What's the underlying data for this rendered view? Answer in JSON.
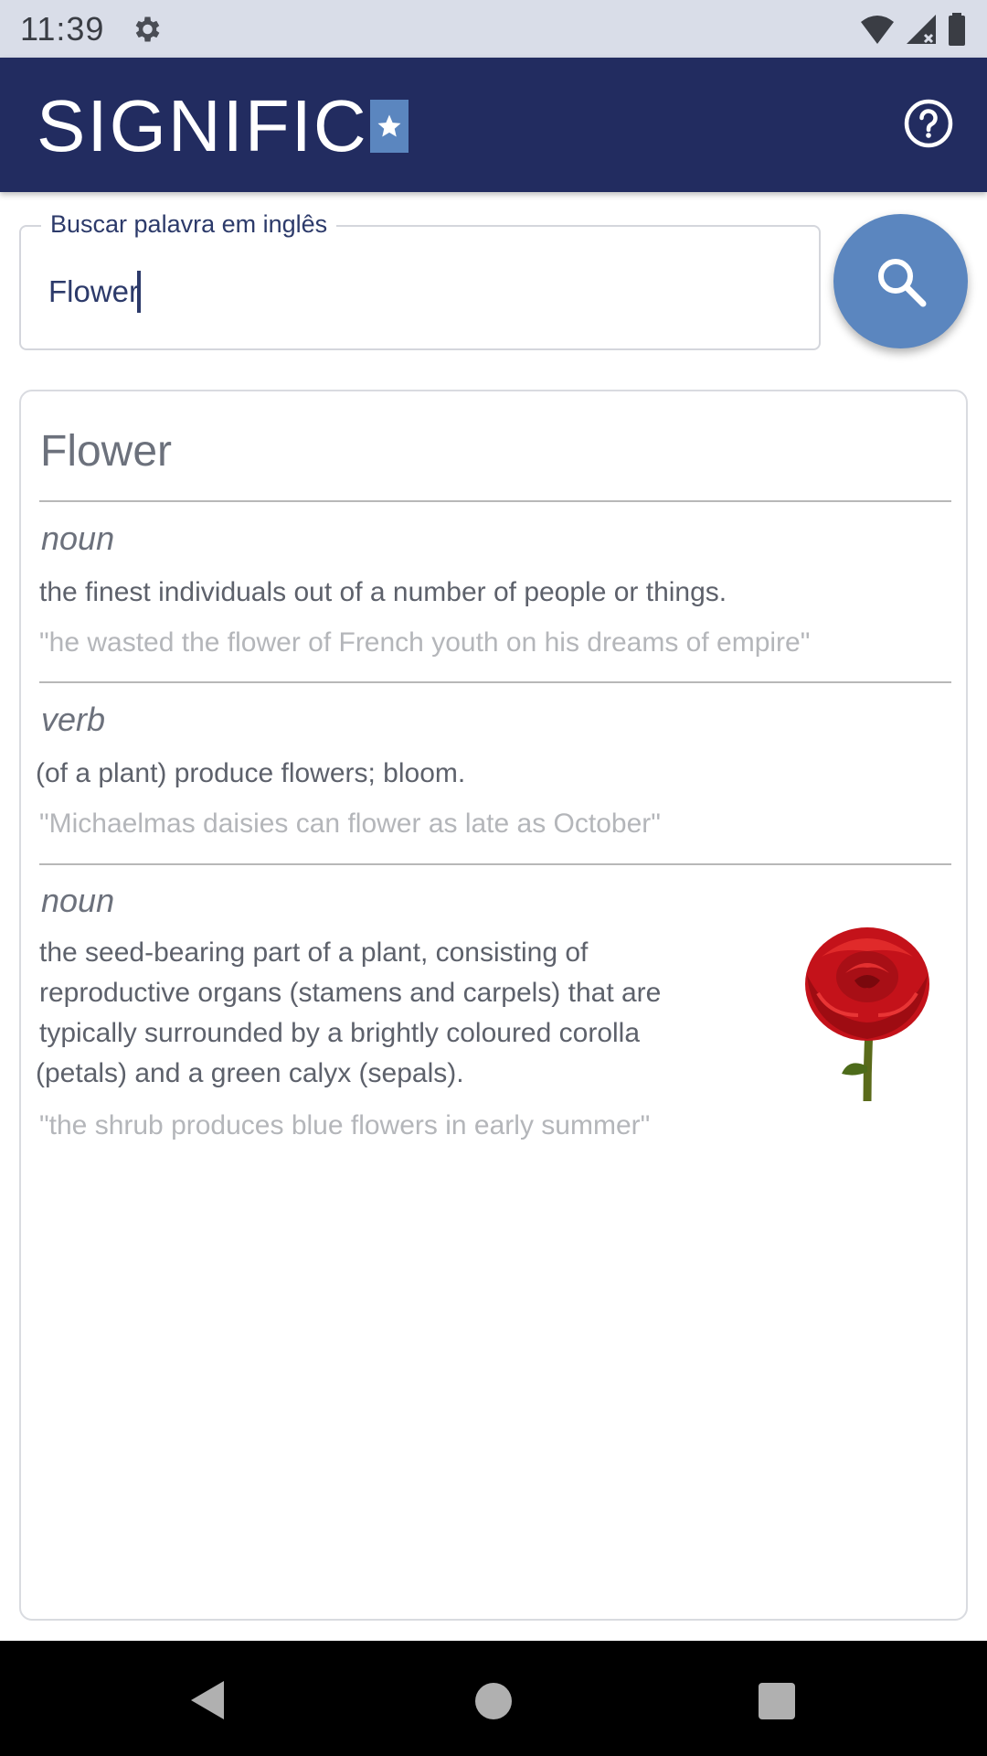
{
  "status_bar": {
    "time": "11:39"
  },
  "app_bar": {
    "logo_text": "SIGNIFIC",
    "logo_star": "★"
  },
  "search": {
    "label": "Buscar palavra em inglês",
    "value": "Flower"
  },
  "result": {
    "word": "Flower",
    "senses": [
      {
        "part_of_speech": "noun",
        "definition": "the finest individuals out of a number of people or things.",
        "example": "\"he wasted the flower of French youth on his dreams of empire\""
      },
      {
        "part_of_speech": "verb",
        "definition": "(of a plant) produce flowers; bloom.",
        "example": "\"Michaelmas daisies can flower as late as October\""
      },
      {
        "part_of_speech": "noun",
        "definition_lines": [
          "the seed-bearing part of a plant, consisting of",
          "reproductive organs (stamens and carpels) that are",
          "typically surrounded by a brightly coloured corolla",
          "(petals) and a green calyx (sepals)."
        ],
        "example": "\"the shrub produces blue flowers in early summer\""
      }
    ]
  },
  "colors": {
    "app_bar": "#222c60",
    "accent": "#5b86bf",
    "status_bar": "#d9dde8"
  }
}
